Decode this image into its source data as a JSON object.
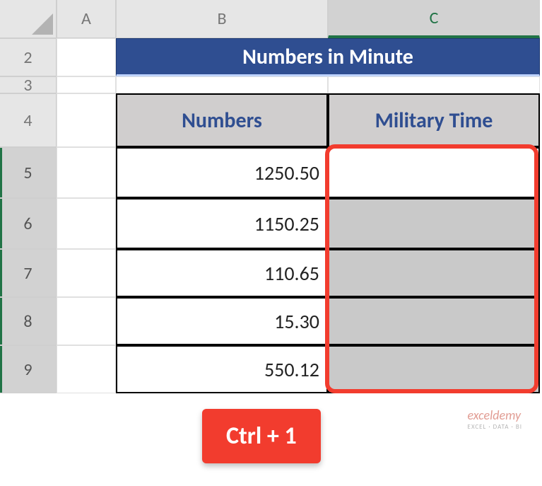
{
  "columns": {
    "A": "A",
    "B": "B",
    "C": "C"
  },
  "rows": [
    "2",
    "3",
    "4",
    "5",
    "6",
    "7",
    "8",
    "9"
  ],
  "title": "Numbers in Minute",
  "headers": {
    "numbers": "Numbers",
    "military": "Military Time"
  },
  "data": {
    "numbers": [
      "1250.50",
      "1150.25",
      "110.65",
      "15.30",
      "550.12"
    ],
    "military": [
      "",
      "",
      "",
      "",
      ""
    ]
  },
  "badge": "Ctrl + 1",
  "watermark": {
    "brand": "exceldemy",
    "tagline": "EXCEL · DATA · BI"
  },
  "chart_data": {
    "type": "table",
    "title": "Numbers in Minute",
    "columns": [
      "Numbers",
      "Military Time"
    ],
    "rows": [
      [
        1250.5,
        null
      ],
      [
        1150.25,
        null
      ],
      [
        110.65,
        null
      ],
      [
        15.3,
        null
      ],
      [
        550.12,
        null
      ]
    ]
  }
}
